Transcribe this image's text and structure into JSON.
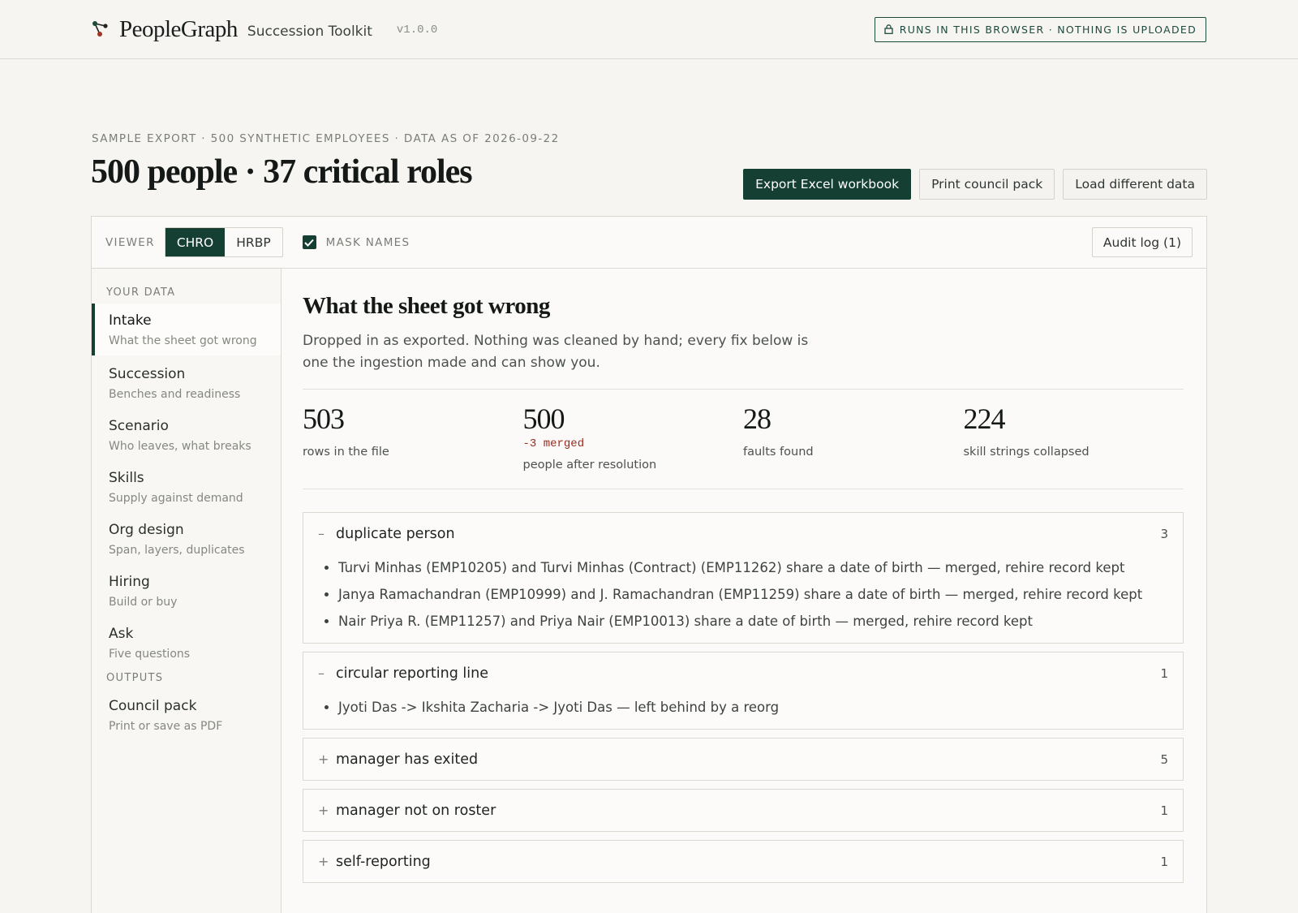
{
  "header": {
    "brand": "PeopleGraph",
    "product": "Succession Toolkit",
    "version": "v1.0.0",
    "privacy_badge": "RUNS IN THIS BROWSER · NOTHING IS UPLOADED"
  },
  "page": {
    "eyebrow": "SAMPLE EXPORT · 500 SYNTHETIC EMPLOYEES · DATA AS OF 2026-09-22",
    "title": "500 people · 37 critical roles"
  },
  "actions": {
    "export": "Export Excel workbook",
    "print": "Print council pack",
    "load": "Load different data"
  },
  "viewer": {
    "label": "VIEWER",
    "options": [
      "CHRO",
      "HRBP"
    ],
    "selected": "CHRO",
    "mask_label": "MASK NAMES",
    "mask_checked": true,
    "audit": "Audit log (1)"
  },
  "sidebar": {
    "section_data": "YOUR DATA",
    "items": [
      {
        "title": "Intake",
        "sub": "What the sheet got wrong"
      },
      {
        "title": "Succession",
        "sub": "Benches and readiness"
      },
      {
        "title": "Scenario",
        "sub": "Who leaves, what breaks"
      },
      {
        "title": "Skills",
        "sub": "Supply against demand"
      },
      {
        "title": "Org design",
        "sub": "Span, layers, duplicates"
      },
      {
        "title": "Hiring",
        "sub": "Build or buy"
      },
      {
        "title": "Ask",
        "sub": "Five questions"
      }
    ],
    "section_outputs": "OUTPUTS",
    "outputs": [
      {
        "title": "Council pack",
        "sub": "Print or save as PDF"
      }
    ]
  },
  "intake": {
    "title": "What the sheet got wrong",
    "description": "Dropped in as exported. Nothing was cleaned by hand; every fix below is one the ingestion made and can show you.",
    "stats": [
      {
        "value": "503",
        "label": "rows in the file"
      },
      {
        "value": "500",
        "delta": "-3 merged",
        "label": "people after resolution"
      },
      {
        "value": "28",
        "label": "faults found"
      },
      {
        "value": "224",
        "label": "skill strings collapsed"
      }
    ],
    "faults": [
      {
        "toggle": "–",
        "name": "duplicate person",
        "count": "3",
        "items": [
          "Turvi Minhas (EMP10205) and Turvi Minhas (Contract) (EMP11262) share a date of birth — merged, rehire record kept",
          "Janya Ramachandran (EMP10999) and J. Ramachandran (EMP11259) share a date of birth — merged, rehire record kept",
          "Nair Priya R. (EMP11257) and Priya Nair (EMP10013) share a date of birth — merged, rehire record kept"
        ]
      },
      {
        "toggle": "–",
        "name": "circular reporting line",
        "count": "1",
        "items": [
          "Jyoti Das -> Ikshita Zacharia -> Jyoti Das — left behind by a reorg"
        ]
      },
      {
        "toggle": "+",
        "name": "manager has exited",
        "count": "5"
      },
      {
        "toggle": "+",
        "name": "manager not on roster",
        "count": "1"
      },
      {
        "toggle": "+",
        "name": "self-reporting",
        "count": "1"
      }
    ]
  },
  "colors": {
    "accent": "#163f33",
    "background": "#f6f5f1",
    "delta": "#9a2b1e"
  }
}
